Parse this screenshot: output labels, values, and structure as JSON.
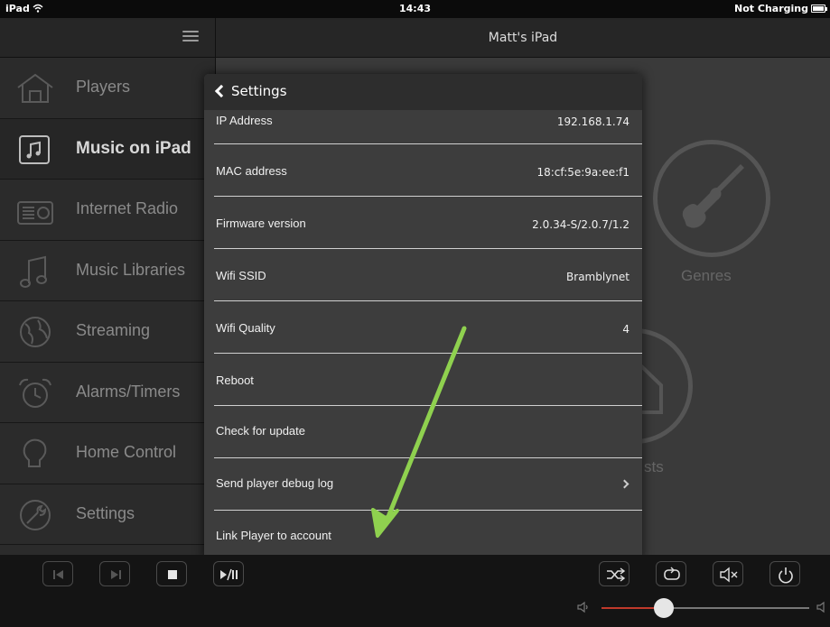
{
  "status_bar": {
    "device": "iPad",
    "wifi_icon": "wifi-icon",
    "time": "14:43",
    "battery_status": "Not Charging"
  },
  "header": {
    "title": "Matt's iPad"
  },
  "sidebar": {
    "items": [
      {
        "label": "Players",
        "icon": "house-icon",
        "active": false
      },
      {
        "label": "Music on iPad",
        "icon": "music-note-square-icon",
        "active": true
      },
      {
        "label": "Internet Radio",
        "icon": "radio-icon",
        "active": false
      },
      {
        "label": "Music Libraries",
        "icon": "music-notes-icon",
        "active": false
      },
      {
        "label": "Streaming",
        "icon": "globe-icon",
        "active": false
      },
      {
        "label": "Alarms/Timers",
        "icon": "alarm-clock-icon",
        "active": false
      },
      {
        "label": "Home Control",
        "icon": "lightbulb-icon",
        "active": false
      },
      {
        "label": "Settings",
        "icon": "wrench-icon",
        "active": false
      }
    ]
  },
  "tiles": {
    "genres_label": "Genres",
    "partial_label": "sts"
  },
  "settings_popover": {
    "back_label": "Settings",
    "rows": [
      {
        "label": "IP Address",
        "value": "192.168.1.74"
      },
      {
        "label": "MAC address",
        "value": "18:cf:5e:9a:ee:f1"
      },
      {
        "label": "Firmware version",
        "value": "2.0.34-S/2.0.7/1.2"
      },
      {
        "label": "Wifi SSID",
        "value": "Bramblynet"
      },
      {
        "label": "Wifi Quality",
        "value": "4"
      },
      {
        "label": "Reboot",
        "value": ""
      },
      {
        "label": "Check for update",
        "value": ""
      },
      {
        "label": "Send player debug log",
        "value": "",
        "chevron": true
      },
      {
        "label": "Link Player to account",
        "value": ""
      }
    ]
  },
  "transport": {
    "buttons": [
      "previous-icon",
      "next-icon",
      "stop-icon",
      "play-pause-icon",
      "shuffle-icon",
      "repeat-icon",
      "mute-icon",
      "power-icon"
    ],
    "volume_level": 0.3
  },
  "colors": {
    "annotation_arrow": "#8fd14f",
    "volume_fill": "#c0392b"
  }
}
